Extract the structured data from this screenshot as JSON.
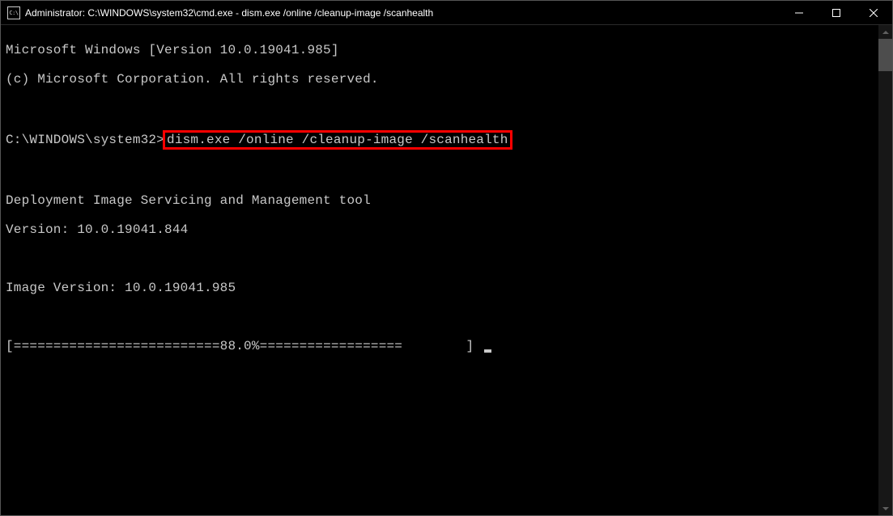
{
  "titlebar": {
    "icon_text": "C:\\",
    "title": "Administrator: C:\\WINDOWS\\system32\\cmd.exe - dism.exe  /online /cleanup-image /scanhealth"
  },
  "terminal": {
    "line1": "Microsoft Windows [Version 10.0.19041.985]",
    "line2": "(c) Microsoft Corporation. All rights reserved.",
    "prompt_prefix": "C:\\WINDOWS\\system32>",
    "command": "dism.exe /online /cleanup-image /scanhealth",
    "tool_name": "Deployment Image Servicing and Management tool",
    "tool_version": "Version: 10.0.19041.844",
    "image_version": "Image Version: 10.0.19041.985",
    "progress_left": "[==========================",
    "progress_pct": "88.0%",
    "progress_right": "==================        ] "
  }
}
